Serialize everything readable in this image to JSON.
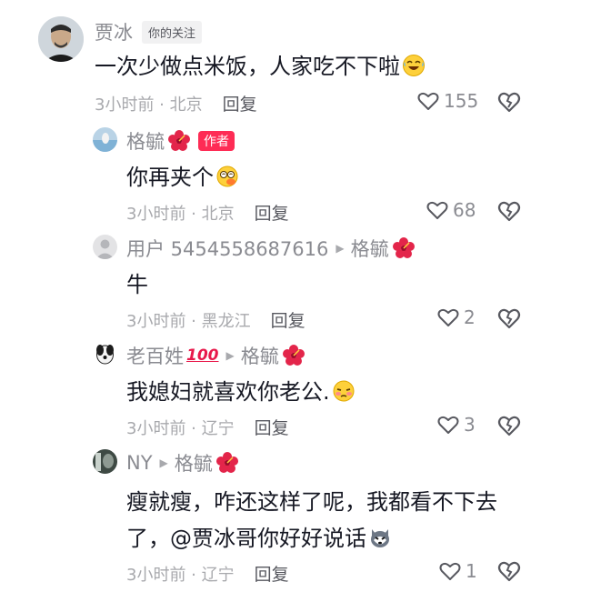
{
  "comments": [
    {
      "name": "贾冰",
      "badge": "你的关注",
      "text": "一次少做点米饭，人家吃不下啦",
      "emoji": "laughing-crying-emoji",
      "time": "3小时前 · 北京",
      "reply": "回复",
      "likes": "155"
    },
    {
      "name": "格毓",
      "name_emoji": "hibiscus-flower",
      "badge": "作者",
      "text": "你再夹个",
      "emoji": "dizzy-face-emoji",
      "time": "3小时前 · 北京",
      "reply": "回复",
      "likes": "68"
    },
    {
      "name": "用户 5454558687616",
      "reply_to": "格毓",
      "text": "牛",
      "time": "3小时前 · 黑龙江",
      "reply": "回复",
      "likes": "2"
    },
    {
      "name": "老百姓",
      "name_suffix": "100",
      "reply_to": "格毓",
      "text": "我媳妇就喜欢你老公.",
      "emoji": "shy-face-emoji",
      "time": "3小时前 · 辽宁",
      "reply": "回复",
      "likes": "3"
    },
    {
      "name": "NY",
      "reply_to": "格毓",
      "text_line1": "瘦就瘦，咋还这样了呢，我都看不下去",
      "text_line2": "了，@贾冰哥你好好说话",
      "emoji": "husky-dog-emoji",
      "time": "3小时前 · 辽宁",
      "reply": "回复",
      "likes": "1"
    }
  ],
  "colors": {
    "author_badge": "#fe2c55",
    "muted": "#8a8b91",
    "text": "#161823"
  }
}
